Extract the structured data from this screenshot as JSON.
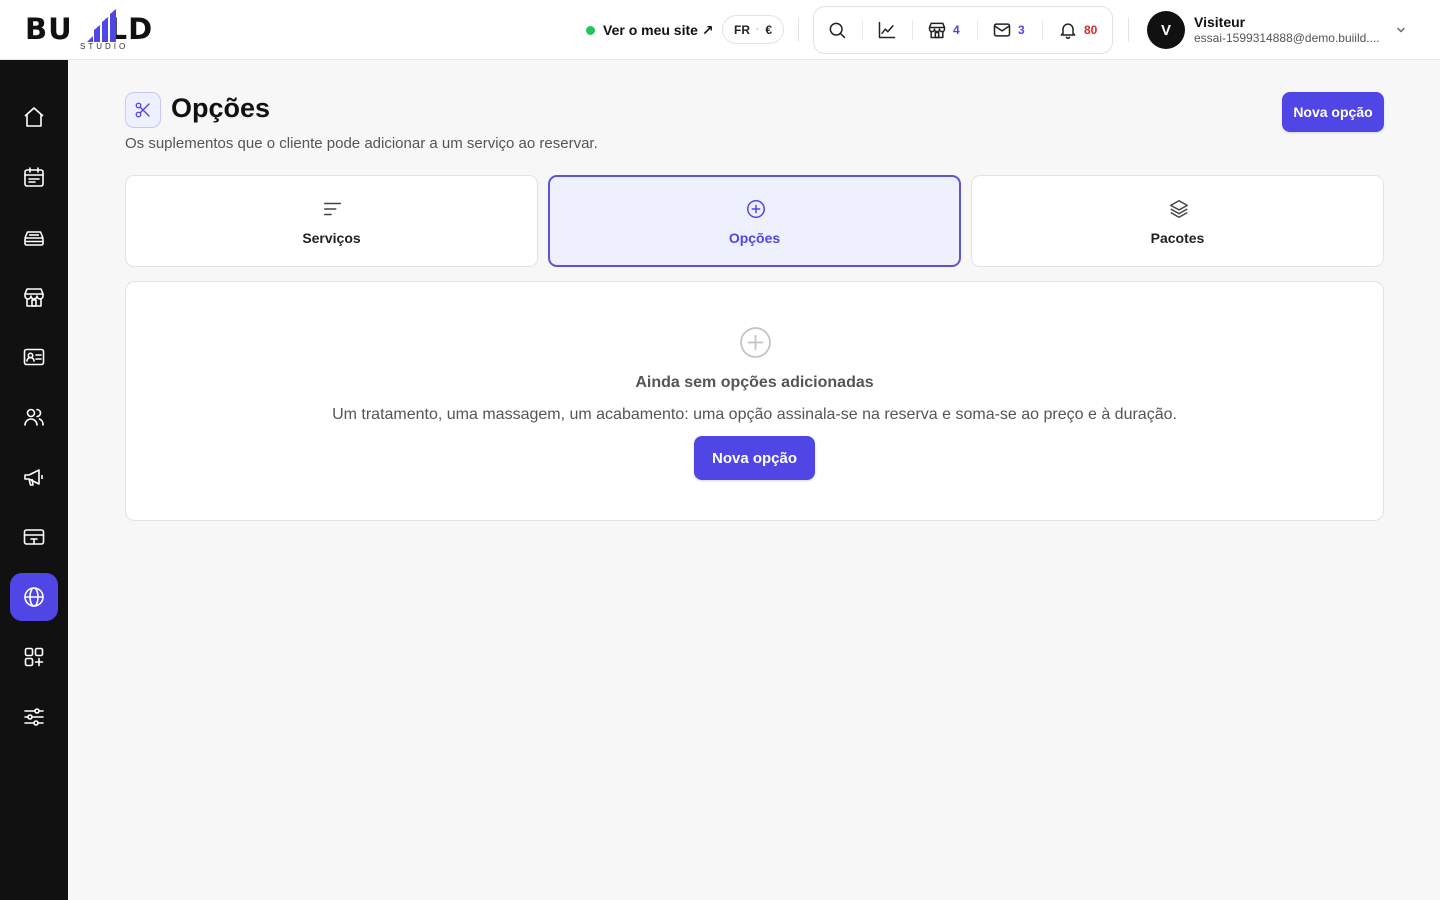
{
  "brand": {
    "word_left": "BU",
    "word_right": "LD",
    "sub": "STUDIO",
    "accent": "#4f46e5"
  },
  "header": {
    "site_link": "Ver o meu site ↗",
    "lang": "FR",
    "currency": "€",
    "counts": {
      "shop": "4",
      "mail": "3",
      "notifications": "80"
    },
    "count_colors": {
      "shop": "#4f46e5",
      "mail": "#4f46e5",
      "notifications": "#dc2626"
    },
    "user": {
      "initial": "V",
      "name": "Visiteur",
      "email": "essai-1599314888@demo.buiild...."
    }
  },
  "sidebar": {
    "items": [
      {
        "icon": "home-icon"
      },
      {
        "icon": "calendar-icon"
      },
      {
        "icon": "inbox-stack-icon"
      },
      {
        "icon": "storefront-icon"
      },
      {
        "icon": "contact-card-icon"
      },
      {
        "icon": "users-icon"
      },
      {
        "icon": "megaphone-icon"
      },
      {
        "icon": "payment-card-icon"
      },
      {
        "icon": "globe-icon",
        "active": true
      },
      {
        "icon": "apps-icon"
      },
      {
        "icon": "sliders-icon"
      }
    ]
  },
  "page": {
    "title": "Opções",
    "subtitle": "Os suplementos que o cliente pode adicionar a um serviço ao reservar.",
    "new_button": "Nova opção"
  },
  "tabs": [
    {
      "label": "Serviços",
      "icon": "lines-icon",
      "active": false
    },
    {
      "label": "Opções",
      "icon": "plus-circle-icon",
      "active": true
    },
    {
      "label": "Pacotes",
      "icon": "layers-icon",
      "active": false
    }
  ],
  "empty": {
    "title": "Ainda sem opções adicionadas",
    "description": "Um tratamento, uma massagem, um acabamento: uma opção assinala-se na reserva e soma-se ao preço e à duração.",
    "button": "Nova opção"
  }
}
